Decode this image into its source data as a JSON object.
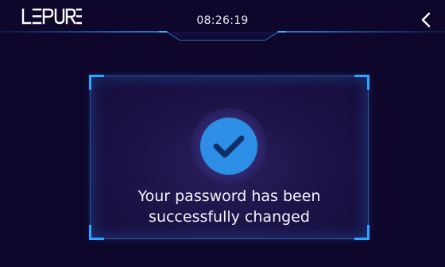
{
  "header": {
    "logo_text": "LEPURE",
    "time": "08:26:19",
    "back_icon": "chevron-left-icon"
  },
  "dialog": {
    "status_icon": "check-circle-icon",
    "message_line1": "Your password has been",
    "message_line2": "successfully changed"
  },
  "colors": {
    "background": "#0e072b",
    "accent": "#2fa6ff",
    "check_circle": "#2d8ee6",
    "text": "#f2f3f8"
  }
}
